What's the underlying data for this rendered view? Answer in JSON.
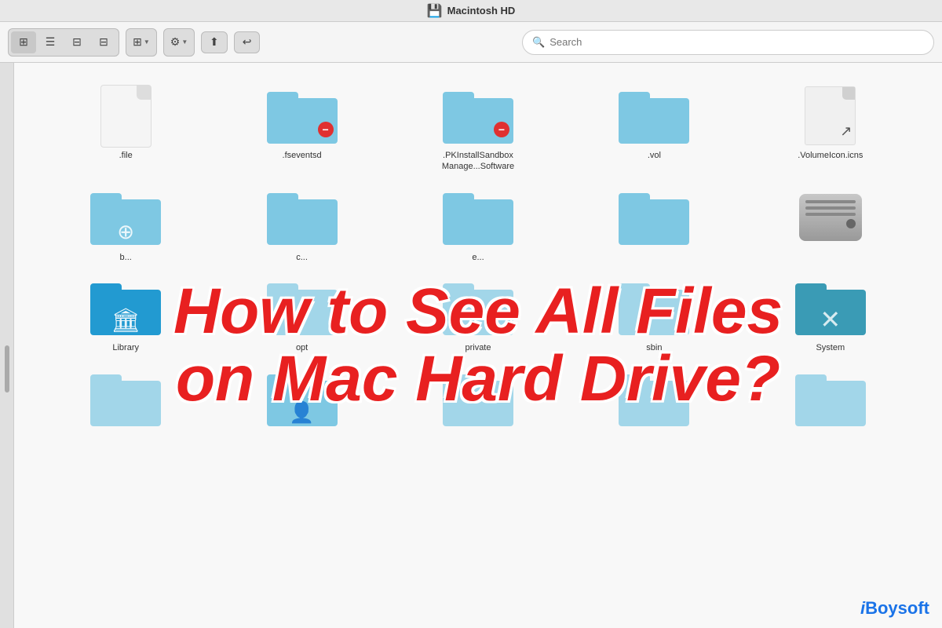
{
  "titleBar": {
    "title": "Macintosh HD",
    "icon": "💾"
  },
  "toolbar": {
    "viewButtons": [
      "grid-icon",
      "list-icon",
      "columns-icon",
      "cover-icon"
    ],
    "groupButton": "Group",
    "gearButton": "Settings",
    "shareButton": "Share",
    "backButton": "Back",
    "searchPlaceholder": "Search"
  },
  "files": {
    "row1": [
      {
        "name": ".file",
        "type": "document"
      },
      {
        "name": ".fseventsd",
        "type": "folder-restricted"
      },
      {
        "name": ".PKInstallSandbox\nManage...Software",
        "type": "folder-restricted"
      },
      {
        "name": ".vol",
        "type": "folder"
      },
      {
        "name": ".VolumeIcon.icns",
        "type": "volumeicon"
      }
    ],
    "row2": [
      {
        "name": "b...",
        "type": "folder-appstore"
      },
      {
        "name": "c...",
        "type": "folder"
      },
      {
        "name": "e...",
        "type": "folder"
      },
      {
        "name": "",
        "type": "folder"
      },
      {
        "name": "",
        "type": "harddrive"
      }
    ],
    "row3": [
      {
        "name": "Library",
        "type": "folder-library"
      },
      {
        "name": "opt",
        "type": "folder-light"
      },
      {
        "name": "private",
        "type": "folder-light"
      },
      {
        "name": "sbin",
        "type": "folder-light"
      },
      {
        "name": "System",
        "type": "folder-system"
      }
    ],
    "row4": [
      {
        "name": "",
        "type": "folder-light"
      },
      {
        "name": "",
        "type": "folder-user"
      },
      {
        "name": "",
        "type": "folder-light"
      },
      {
        "name": "",
        "type": "folder-light"
      },
      {
        "name": "",
        "type": "folder-light"
      }
    ]
  },
  "overlay": {
    "line1": "How to See All Files",
    "line2": "on Mac Hard Drive?"
  },
  "watermark": {
    "prefix": "i",
    "suffix": "Boysoft"
  }
}
